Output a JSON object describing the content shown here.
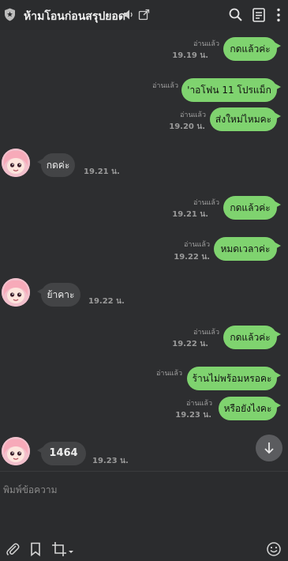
{
  "header": {
    "title": "ห้ามโอนก่อนสรุปยอด"
  },
  "messages": {
    "m1": {
      "text": "กดแล้วค่ะ",
      "read": "อ่านแล้ว",
      "time": "19.19 น."
    },
    "m2": {
      "text": "'าอโฟน 11 โปรแม็ก",
      "read": "อ่านแล้ว"
    },
    "m3": {
      "text": "ส่งใหม่ไหมคะ",
      "read": "อ่านแล้ว",
      "time": "19.20 น."
    },
    "m4": {
      "text": "กดค่ะ",
      "time": "19.21 น."
    },
    "m5": {
      "text": "กดแล้วค่ะ",
      "read": "อ่านแล้ว",
      "time": "19.21 น."
    },
    "m6": {
      "text": "หมดเวลาค่ะ",
      "read": "อ่านแล้ว",
      "time": "19.22 น."
    },
    "m7": {
      "text": "ย้าคาะ",
      "time": "19.22 น."
    },
    "m8": {
      "text": "กดแล้วค่ะ",
      "read": "อ่านแล้ว",
      "time": "19.22 น."
    },
    "m9": {
      "text": "ร้านไม่พร้อมหรอคะ",
      "read": "อ่านแล้ว"
    },
    "m10": {
      "text": "หรือยังไงคะ",
      "read": "อ่านแล้ว",
      "time": "19.23 น."
    },
    "m11": {
      "text": "1464",
      "time": "19.23 น."
    }
  },
  "composer": {
    "placeholder": "พิมพ์ข้อความ"
  },
  "colors": {
    "outgoing_bubble": "#7fd36f",
    "incoming_bubble": "#434446",
    "background": "#2d2e30"
  },
  "icons": [
    "shield-icon",
    "mute-icon",
    "external-link-icon",
    "search-icon",
    "notes-icon",
    "more-vertical-icon",
    "chevron-down-icon",
    "attach-icon",
    "bookmark-icon",
    "crop-icon",
    "emoji-icon"
  ]
}
